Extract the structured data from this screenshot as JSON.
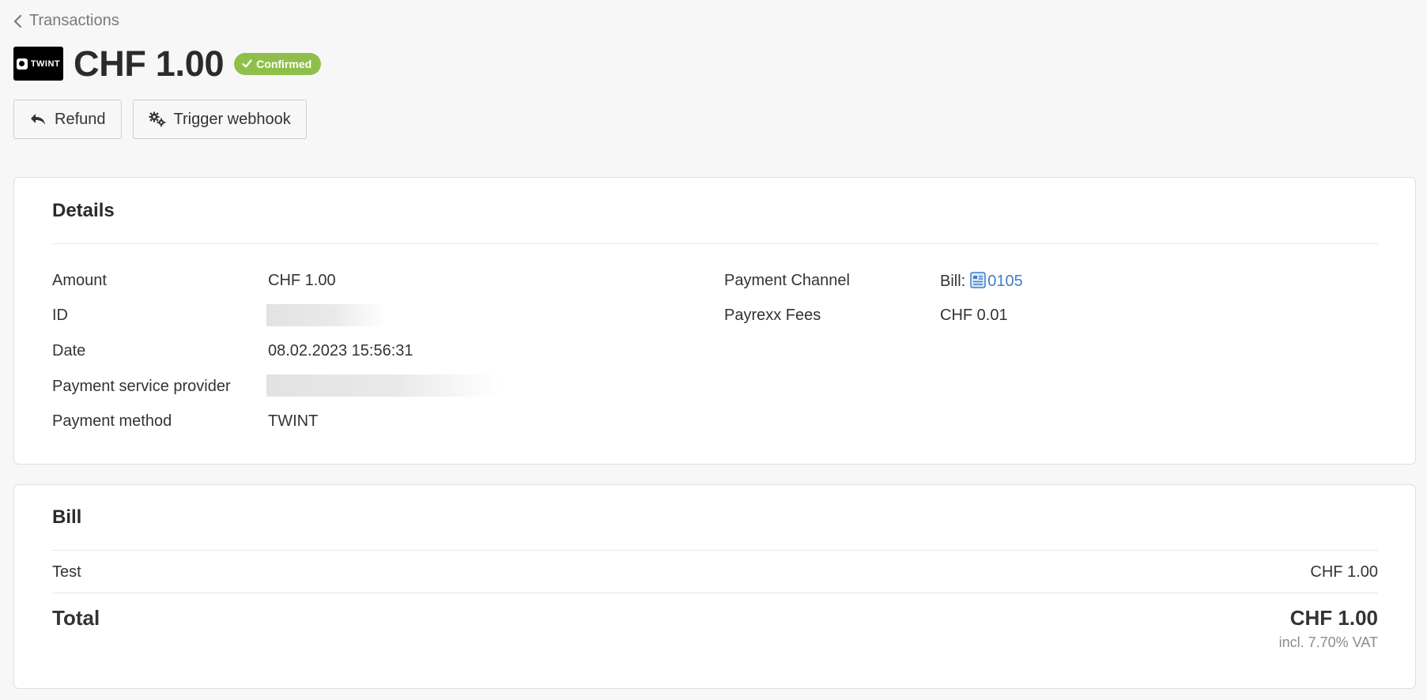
{
  "nav": {
    "back_label": "Transactions"
  },
  "header": {
    "logo_text": "TWINT",
    "amount_title": "CHF 1.00",
    "status_badge": "Confirmed"
  },
  "actions": {
    "refund_label": "Refund",
    "webhook_label": "Trigger webhook"
  },
  "details": {
    "title": "Details",
    "left": [
      {
        "key": "Amount",
        "value": "CHF 1.00"
      },
      {
        "key": "ID",
        "value": ""
      },
      {
        "key": "Date",
        "value": "08.02.2023 15:56:31"
      },
      {
        "key": "Payment service provider",
        "value": ""
      },
      {
        "key": "Payment method",
        "value": "TWINT"
      }
    ],
    "right": [
      {
        "key": "Payment Channel",
        "value_prefix": "Bill:",
        "link": "0105"
      },
      {
        "key": "Payrexx Fees",
        "value": "CHF 0.01"
      }
    ]
  },
  "bill": {
    "title": "Bill",
    "items": [
      {
        "name": "Test",
        "amount": "CHF 1.00"
      }
    ],
    "total_label": "Total",
    "total_value": "CHF 1.00",
    "vat_note": "incl. 7.70% VAT"
  },
  "colors": {
    "badge_green": "#8fbf4a",
    "link_blue": "#3d7fc9",
    "background": "#f7f7f7"
  }
}
